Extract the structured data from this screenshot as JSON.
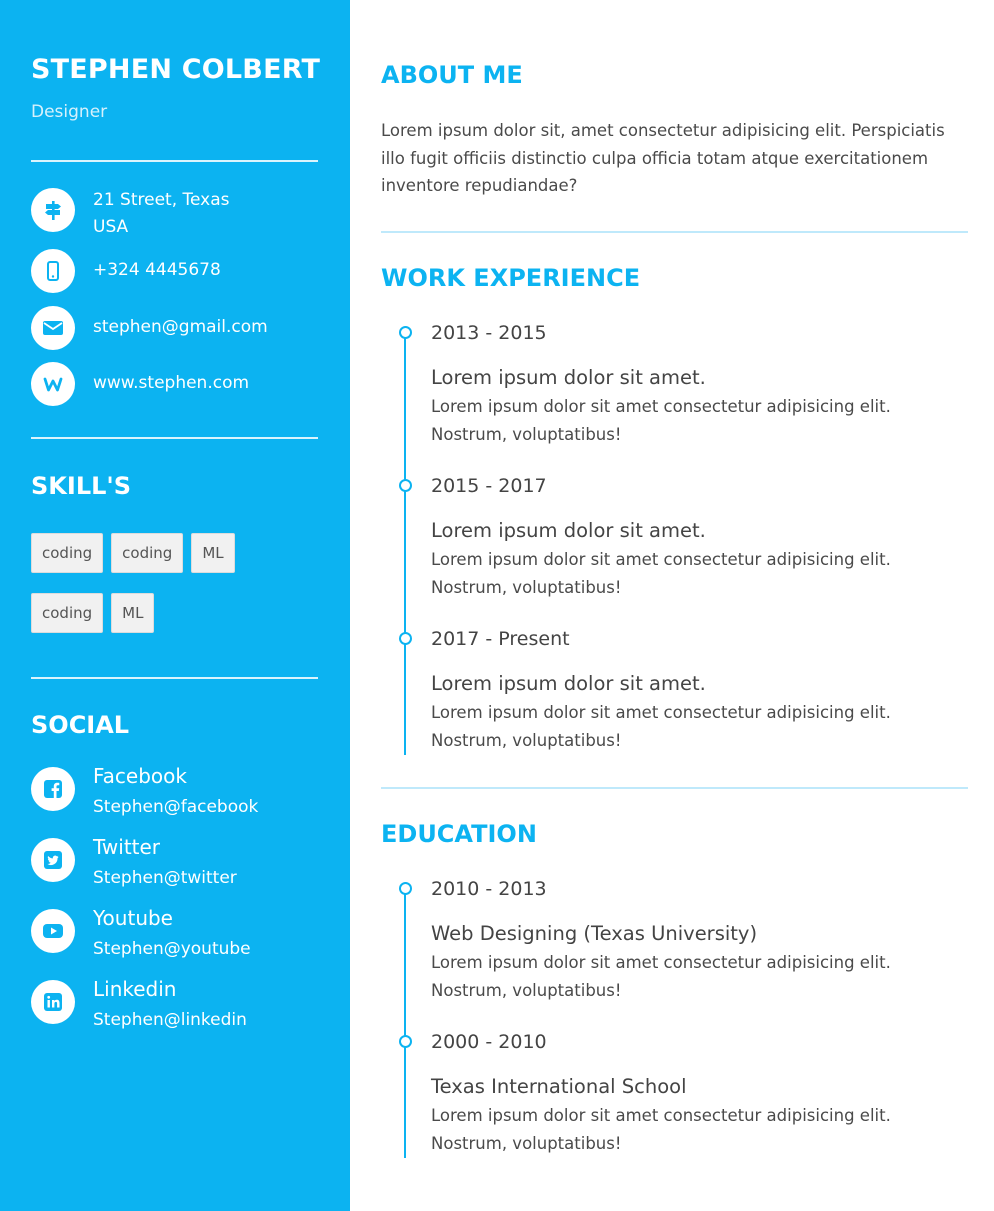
{
  "profile": {
    "name": "STEPHEN COLBERT",
    "role": "Designer"
  },
  "contact": {
    "address_line1": "21 Street, Texas",
    "address_line2": "USA",
    "phone": "+324 4445678",
    "email": "stephen@gmail.com",
    "website": "www.stephen.com",
    "icons": [
      "signpost-icon",
      "phone-icon",
      "mail-icon",
      "website-icon"
    ]
  },
  "skills": {
    "heading": "SKILL'S",
    "items": [
      "coding",
      "coding",
      "ML",
      "coding",
      "ML"
    ]
  },
  "social": {
    "heading": "SOCIAL",
    "items": [
      {
        "platform": "Facebook",
        "handle": "Stephen@facebook",
        "icon": "facebook-icon"
      },
      {
        "platform": "Twitter",
        "handle": "Stephen@twitter",
        "icon": "twitter-icon"
      },
      {
        "platform": "Youtube",
        "handle": "Stephen@youtube",
        "icon": "youtube-icon"
      },
      {
        "platform": "Linkedin",
        "handle": "Stephen@linkedin",
        "icon": "linkedin-icon"
      }
    ]
  },
  "about": {
    "heading": "ABOUT ME",
    "text": "Lorem ipsum dolor sit, amet consectetur adipisicing elit. Perspiciatis illo fugit officiis distinctio culpa officia totam atque exercitationem inventore repudiandae?"
  },
  "work": {
    "heading": "WORK EXPERIENCE",
    "entries": [
      {
        "period": "2013 - 2015",
        "title": "Lorem ipsum dolor sit amet.",
        "desc": "Lorem ipsum dolor sit amet consectetur adipisicing elit. Nostrum, voluptatibus!"
      },
      {
        "period": "2015 - 2017",
        "title": "Lorem ipsum dolor sit amet.",
        "desc": "Lorem ipsum dolor sit amet consectetur adipisicing elit. Nostrum, voluptatibus!"
      },
      {
        "period": "2017 - Present",
        "title": "Lorem ipsum dolor sit amet.",
        "desc": "Lorem ipsum dolor sit amet consectetur adipisicing elit. Nostrum, voluptatibus!"
      }
    ]
  },
  "education": {
    "heading": "EDUCATION",
    "entries": [
      {
        "period": "2010 - 2013",
        "title": "Web Designing (Texas University)",
        "desc": "Lorem ipsum dolor sit amet consectetur adipisicing elit. Nostrum, voluptatibus!"
      },
      {
        "period": "2000 - 2010",
        "title": "Texas International School",
        "desc": "Lorem ipsum dolor sit amet consectetur adipisicing elit. Nostrum, voluptatibus!"
      }
    ]
  },
  "colors": {
    "accent": "#0cb3f1",
    "divider": "#bfe9fb",
    "text": "#4a4a4a"
  }
}
